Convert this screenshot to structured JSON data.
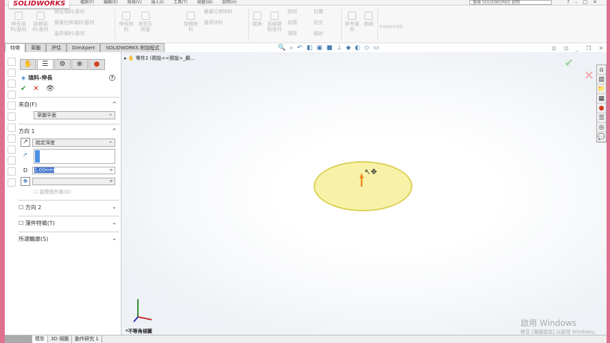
{
  "app": {
    "logo": "SOLIDWORKS",
    "menus": [
      "檔案(F)",
      "編輯(E)",
      "檢視(V)",
      "插入(I)",
      "工具(T)",
      "視窗(W)",
      "說明(H)"
    ],
    "search_placeholder": "搜尋 SOLIDWORKS 說明"
  },
  "ribbon": {
    "items": [
      "伸長填料/基材",
      "旋轉填料/基材",
      "掃出填料/基材",
      "疊層拉伸填料/基材",
      "邊界填料/基材",
      "伸長除料",
      "異型孔精靈",
      "旋轉除料",
      "疊層拉伸除料",
      "邊界除料",
      "圓角",
      "直線複製排列",
      "肋材",
      "拔模",
      "薄殼",
      "包覆",
      "相交",
      "鏡射",
      "參考幾何",
      "曲線",
      "Instant3D"
    ]
  },
  "tabs": [
    "特徵",
    "草圖",
    "評估",
    "DimXpert",
    "SOLIDWORKS 附加程式"
  ],
  "panel": {
    "title": "填料-伸長",
    "from": {
      "label": "來自(F)",
      "value": "草圖平面"
    },
    "dir1": {
      "label": "方向 1",
      "end_condition": "給定深度",
      "depth": "1.00mm",
      "draft_label": "拔模面外張(O)"
    },
    "dir2": "方向 2",
    "thin": "薄件特徵(T)",
    "contours": "所選輪廓(S)"
  },
  "tree": {
    "item": "零件2 (預設<<預設>_顯..."
  },
  "view": {
    "name": "*不等角視圖"
  },
  "watermark": {
    "title": "啟用 Windows",
    "sub": "移至 [電腦設定] 以啟用 Windows。"
  },
  "bottom_tabs": [
    "模型",
    "3D 視圖",
    "動作研究 1"
  ]
}
